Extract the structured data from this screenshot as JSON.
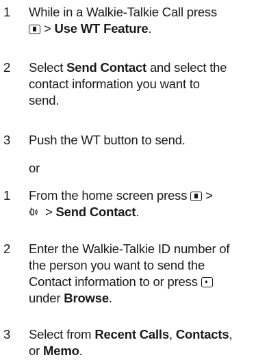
{
  "procedure_a": {
    "step1": {
      "num": "1",
      "line1": "While in a Walkie-Talkie Call press",
      "sep": ">",
      "bold": "Use WT Feature",
      "end": "."
    },
    "step2": {
      "num": "2",
      "pre": "Select",
      "bold": "Send Contact",
      "line1_rest": "and select the",
      "line2": "contact information you want to",
      "line3": "send."
    },
    "step3": {
      "num": "3",
      "line1": "Push the WT button to send."
    }
  },
  "or_label": "or",
  "procedure_b": {
    "step1": {
      "num": "1",
      "line1": "From the home screen press",
      "sep1": ">",
      "sep2": ">",
      "bold": "Send Contact",
      "end": "."
    },
    "step2": {
      "num": "2",
      "line1": "Enter the Walkie-Talkie ID number of",
      "line2": "the person you want to send the",
      "line3": "Contact information to or press",
      "line4_pre": "under",
      "bold": "Browse",
      "end": "."
    },
    "step3": {
      "num": "3",
      "pre": "Select from",
      "bold1": "Recent Calls",
      "comma": ",",
      "bold2": "Contacts",
      "end1": ",",
      "line2_pre": "or",
      "bold3": "Memo",
      "end2": "."
    }
  },
  "icons": {
    "menu_key": "menu-key-icon",
    "wt_feature": "walkie-talkie-icon",
    "center_key": "center-select-key-icon"
  }
}
